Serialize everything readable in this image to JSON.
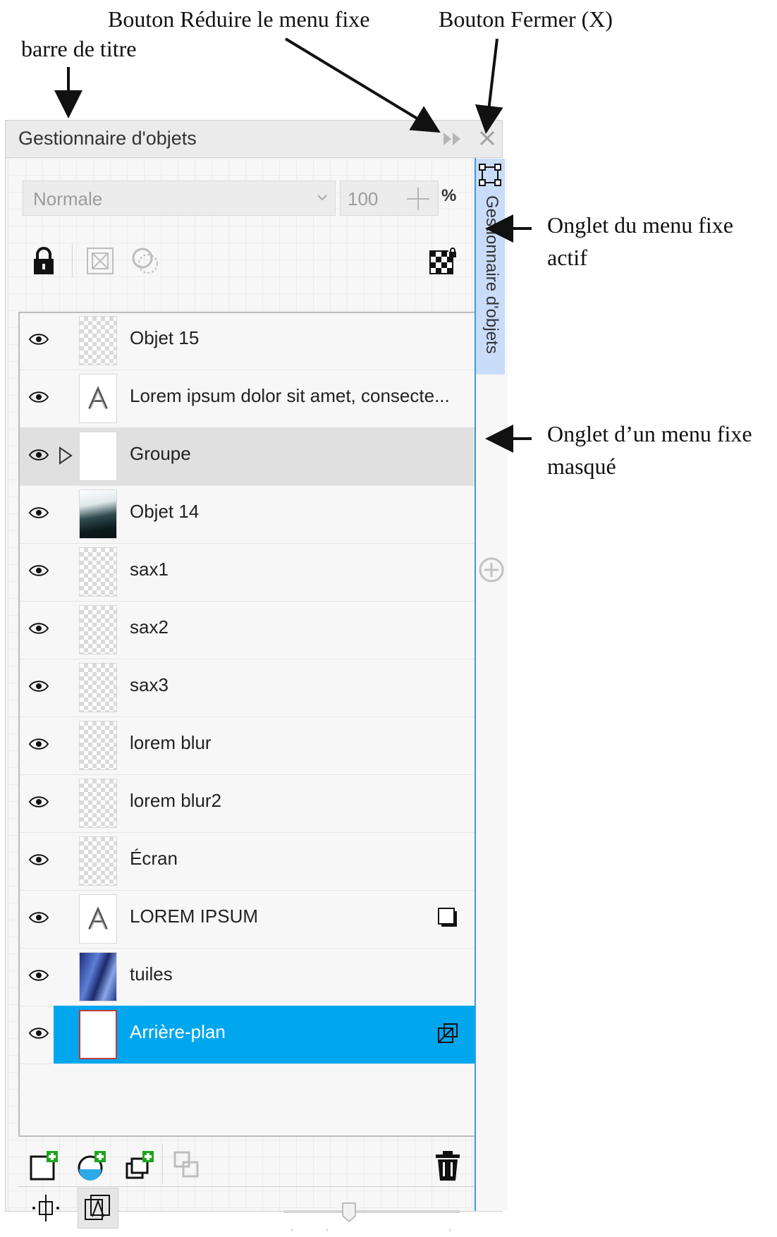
{
  "annotations": {
    "titlebar": "barre de titre",
    "collapse_button": "Bouton Réduire le menu fixe",
    "close_button": "Bouton Fermer (X)",
    "active_tab_line1": "Onglet du menu fixe",
    "active_tab_line2": "actif",
    "hidden_tab_line1": "Onglet d’un menu fixe",
    "hidden_tab_line2": "masqué"
  },
  "panel": {
    "title": "Gestionnaire d'objets",
    "blend_mode": "Normale",
    "opacity": "100",
    "opacity_unit": "%",
    "dock_tab_label": "Gestionnaire d'objets"
  },
  "objects": [
    {
      "name": "Objet 15",
      "thumb": "transparent",
      "right_icon": ""
    },
    {
      "name": "Lorem ipsum dolor sit amet, consecte...",
      "thumb": "text",
      "right_icon": ""
    },
    {
      "name": "Groupe",
      "thumb": "plain",
      "right_icon": "",
      "expandable": true
    },
    {
      "name": "Objet 14",
      "thumb": "photo",
      "right_icon": ""
    },
    {
      "name": "sax1",
      "thumb": "transparent",
      "right_icon": ""
    },
    {
      "name": "sax2",
      "thumb": "transparent",
      "right_icon": ""
    },
    {
      "name": "sax3",
      "thumb": "transparent",
      "right_icon": ""
    },
    {
      "name": "lorem blur",
      "thumb": "transparent",
      "right_icon": ""
    },
    {
      "name": "lorem blur2",
      "thumb": "transparent",
      "right_icon": ""
    },
    {
      "name": "Écran",
      "thumb": "transparent",
      "right_icon": ""
    },
    {
      "name": "LOREM IPSUM",
      "thumb": "text",
      "right_icon": "shadow-square-icon"
    },
    {
      "name": "tuiles",
      "thumb": "tiles",
      "right_icon": ""
    },
    {
      "name": "Arrière-plan",
      "thumb": "background",
      "right_icon": "page-background-icon",
      "selected": true
    }
  ],
  "icons": {
    "toolbar": [
      "lock-icon",
      "disable-icon",
      "visibility-circle-icon",
      "checker-lock-icon"
    ],
    "bottom": [
      "new-layer-icon",
      "new-master-layer-icon",
      "new-object-icon",
      "combine-icon",
      "trash-icon"
    ],
    "bottom2": [
      "snap-center-icon",
      "view-objects-icon"
    ]
  },
  "colors": {
    "selection": "#00a6ee",
    "dock_tab": "#c9dcfa",
    "dock_border": "#3b9be0"
  }
}
